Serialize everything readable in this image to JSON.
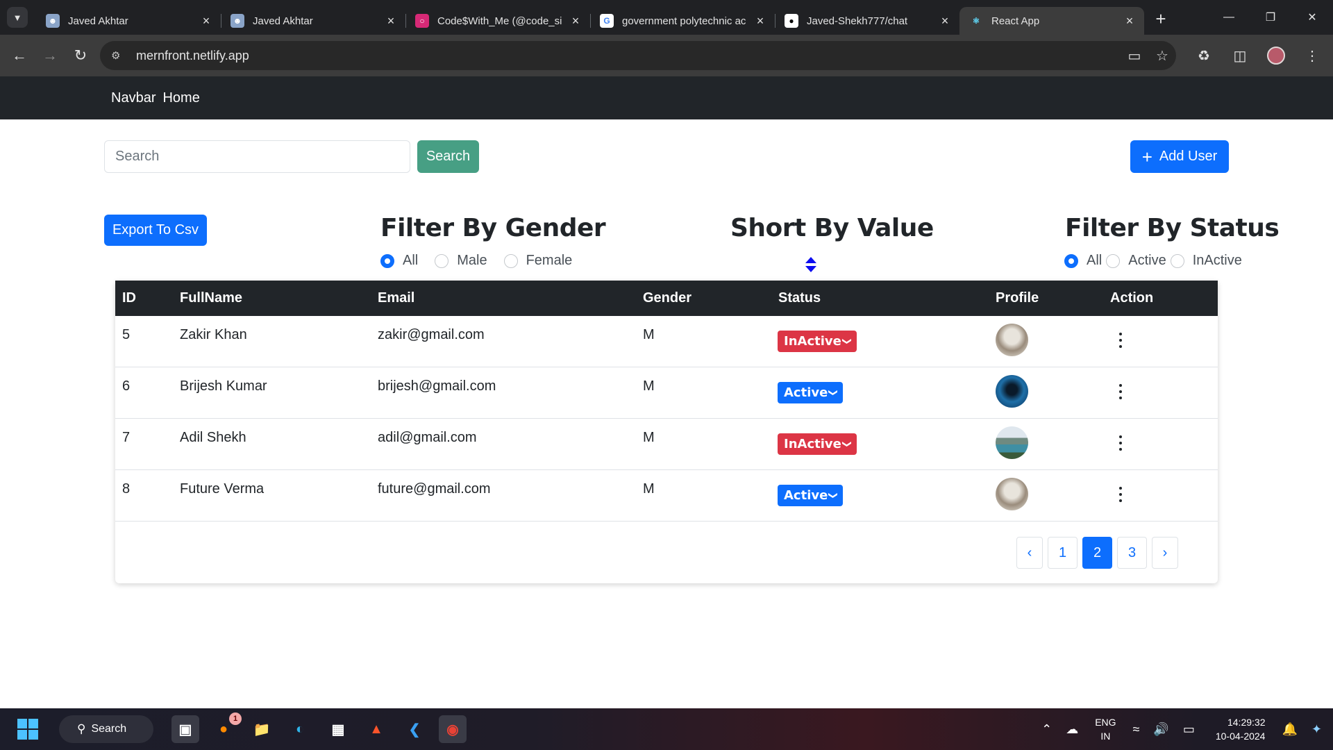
{
  "browser": {
    "tabs": [
      {
        "title": "Javed Akhtar",
        "favicon": "person-photo-icon",
        "active": false
      },
      {
        "title": "Javed Akhtar",
        "favicon": "person-photo-icon",
        "active": false
      },
      {
        "title": "Code$With_Me (@code_si",
        "favicon": "instagram-icon",
        "active": false
      },
      {
        "title": "government polytechnic ac",
        "favicon": "google-icon",
        "active": false
      },
      {
        "title": "Javed-Shekh777/chat",
        "favicon": "github-icon",
        "active": false
      },
      {
        "title": "React App",
        "favicon": "react-icon",
        "active": true
      }
    ],
    "url": "mernfront.netlify.app"
  },
  "navbar": {
    "brand": "Navbar",
    "home": "Home"
  },
  "search": {
    "placeholder": "Search",
    "button_label": "Search"
  },
  "add_user": {
    "label": "Add User"
  },
  "export": {
    "label": "Export To Csv"
  },
  "filters": {
    "gender": {
      "title": "Filter By Gender",
      "options": [
        "All",
        "Male",
        "Female"
      ],
      "selected": "All"
    },
    "sort": {
      "title": "Short By Value"
    },
    "status": {
      "title": "Filter By Status",
      "options": [
        "All",
        "Active",
        "InActive"
      ],
      "selected": "All"
    }
  },
  "table": {
    "headers": [
      "ID",
      "FullName",
      "Email",
      "Gender",
      "Status",
      "Profile",
      "Action"
    ],
    "rows": [
      {
        "id": "5",
        "name": "Zakir Khan",
        "email": "zakir@gmail.com",
        "gender": "M",
        "status": "InActive",
        "profile": "old-man-photo"
      },
      {
        "id": "6",
        "name": "Brijesh Kumar",
        "email": "brijesh@gmail.com",
        "gender": "M",
        "status": "Active",
        "profile": "blue-silhouette-photo"
      },
      {
        "id": "7",
        "name": "Adil Shekh",
        "email": "adil@gmail.com",
        "gender": "M",
        "status": "InActive",
        "profile": "mountain-lake-photo"
      },
      {
        "id": "8",
        "name": "Future Verma",
        "email": "future@gmail.com",
        "gender": "M",
        "status": "Active",
        "profile": "old-man-photo"
      }
    ]
  },
  "pagination": {
    "prev": "‹",
    "pages": [
      "1",
      "2",
      "3"
    ],
    "current": "2",
    "next": "›"
  },
  "taskbar": {
    "search_label": "Search",
    "lang_line1": "ENG",
    "lang_line2": "IN",
    "time": "14:29:32",
    "date": "10-04-2024",
    "firefox_badge": "1"
  },
  "colors": {
    "primary": "#0d6efd",
    "danger": "#dc3545",
    "success_teal": "#479f84",
    "dark": "#212529"
  }
}
